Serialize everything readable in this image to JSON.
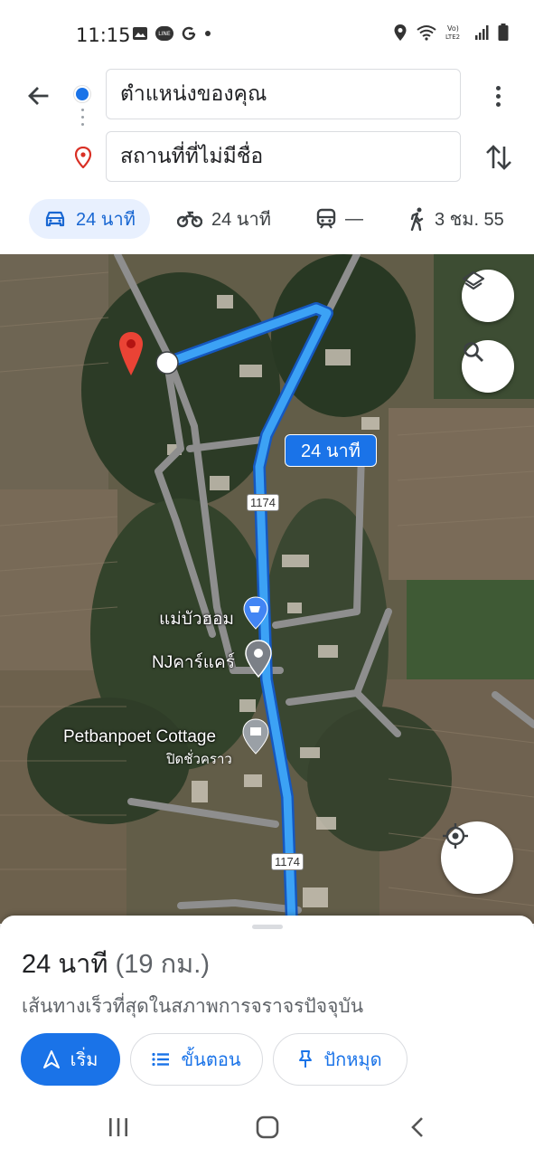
{
  "status_bar": {
    "time": "11:15",
    "left_icons": [
      "gallery-icon",
      "line-icon",
      "google-icon",
      "dot-icon"
    ],
    "right_icons": [
      "location-icon",
      "wifi-icon",
      "volte-icon",
      "signal-icon",
      "battery-icon"
    ],
    "volte_label": "Vo)\nLTE2"
  },
  "directions": {
    "origin": "ตำแหน่งของคุณ",
    "destination": "สถานที่ที่ไม่มีชื่อ"
  },
  "modes": [
    {
      "id": "car",
      "label": "24 นาที",
      "active": true
    },
    {
      "id": "motorcycle",
      "label": "24 นาที",
      "active": false
    },
    {
      "id": "transit",
      "label": "—",
      "active": false
    },
    {
      "id": "walk",
      "label": "3 ชม. 55",
      "active": false
    }
  ],
  "map": {
    "route_time_label": "24 นาที",
    "road_shield_1": "1174",
    "road_shield_2": "1174",
    "poi_shop": "แม่บัวฮอม",
    "poi_car": "NJคาร์แคร์",
    "poi_cottage": "Petbanpoet Cottage",
    "poi_cottage_status": "ปิดชั่วคราว",
    "route_color": "#1a73e8",
    "pin_color": "#d93025"
  },
  "sheet": {
    "duration": "24 นาที",
    "distance": "(19 กม.)",
    "description": "เส้นทางเร็วที่สุดในสภาพการจราจรปัจจุบัน",
    "start_label": "เริ่ม",
    "steps_label": "ขั้นตอน",
    "pin_label": "ปักหมุด"
  }
}
